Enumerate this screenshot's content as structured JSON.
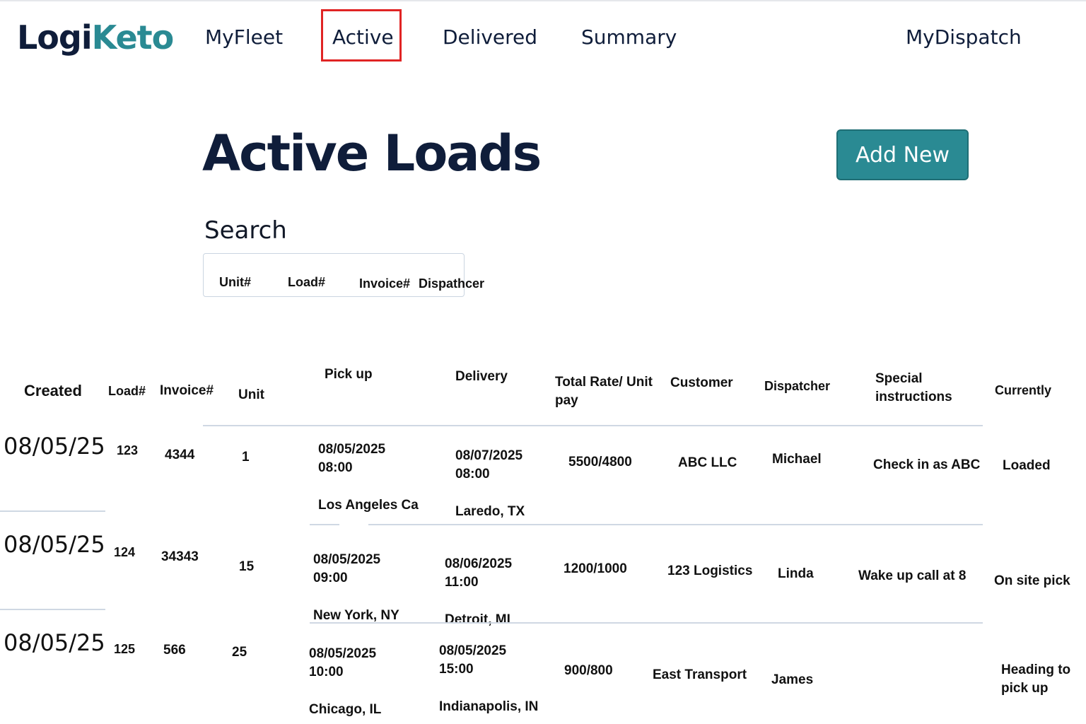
{
  "brand": {
    "logo_part1": "Logi",
    "logo_part2": "Keto"
  },
  "nav": {
    "myfleet": "MyFleet",
    "active": "Active",
    "delivered": "Delivered",
    "summary": "Summary",
    "mydispatch": "MyDispatch"
  },
  "page": {
    "title": "Active Loads",
    "add_new_label": "Add New"
  },
  "search": {
    "label": "Search",
    "fields": [
      "Unit#",
      "Load#",
      "Invoice#",
      "Dispathcer"
    ]
  },
  "table": {
    "headers": {
      "created": "Created",
      "load": "Load#",
      "invoice": "Invoice#",
      "unit": "Unit",
      "pickup": "Pick up",
      "delivery": "Delivery",
      "rate": "Total Rate/ Unit pay",
      "customer": "Customer",
      "dispatcher": "Dispatcher",
      "special": "Special instructions",
      "currently": "Currently"
    },
    "rows": [
      {
        "created": "08/05/25",
        "load": "123",
        "invoice": "4344",
        "unit": "1",
        "pickup_datetime": "08/05/2025\n08:00",
        "pickup_location": "Los Angeles Ca",
        "delivery_datetime": "08/07/2025\n08:00",
        "delivery_location": "Laredo, TX",
        "rate": "5500/4800",
        "customer": "ABC LLC",
        "dispatcher": "Michael",
        "special": "Check in as ABC",
        "currently": "Loaded"
      },
      {
        "created": "08/05/25",
        "load": "124",
        "invoice": "34343",
        "unit": "15",
        "pickup_datetime": "08/05/2025\n09:00",
        "pickup_location": "New York, NY",
        "delivery_datetime": "08/06/2025\n11:00",
        "delivery_location": "Detroit, MI",
        "rate": "1200/1000",
        "customer": "123 Logistics",
        "dispatcher": "Linda",
        "special": "Wake up call at 8",
        "currently": "On site pick"
      },
      {
        "created": "08/05/25",
        "load": "125",
        "invoice": "566",
        "unit": "25",
        "pickup_datetime": "08/05/2025\n10:00",
        "pickup_location": "Chicago, IL",
        "delivery_datetime": "08/05/2025\n15:00",
        "delivery_location": "Indianapolis, IN",
        "rate": "900/800",
        "customer": "East Transport",
        "dispatcher": "James",
        "special": "",
        "currently": "Heading to\npick up"
      }
    ]
  }
}
